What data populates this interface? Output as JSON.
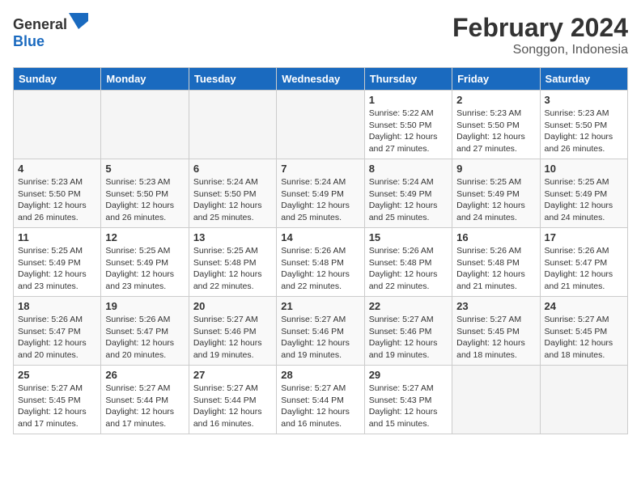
{
  "header": {
    "logo_general": "General",
    "logo_blue": "Blue",
    "month_title": "February 2024",
    "location": "Songgon, Indonesia"
  },
  "days_of_week": [
    "Sunday",
    "Monday",
    "Tuesday",
    "Wednesday",
    "Thursday",
    "Friday",
    "Saturday"
  ],
  "weeks": [
    [
      {
        "day": "",
        "info": ""
      },
      {
        "day": "",
        "info": ""
      },
      {
        "day": "",
        "info": ""
      },
      {
        "day": "",
        "info": ""
      },
      {
        "day": "1",
        "info": "Sunrise: 5:22 AM\nSunset: 5:50 PM\nDaylight: 12 hours\nand 27 minutes."
      },
      {
        "day": "2",
        "info": "Sunrise: 5:23 AM\nSunset: 5:50 PM\nDaylight: 12 hours\nand 27 minutes."
      },
      {
        "day": "3",
        "info": "Sunrise: 5:23 AM\nSunset: 5:50 PM\nDaylight: 12 hours\nand 26 minutes."
      }
    ],
    [
      {
        "day": "4",
        "info": "Sunrise: 5:23 AM\nSunset: 5:50 PM\nDaylight: 12 hours\nand 26 minutes."
      },
      {
        "day": "5",
        "info": "Sunrise: 5:23 AM\nSunset: 5:50 PM\nDaylight: 12 hours\nand 26 minutes."
      },
      {
        "day": "6",
        "info": "Sunrise: 5:24 AM\nSunset: 5:50 PM\nDaylight: 12 hours\nand 25 minutes."
      },
      {
        "day": "7",
        "info": "Sunrise: 5:24 AM\nSunset: 5:49 PM\nDaylight: 12 hours\nand 25 minutes."
      },
      {
        "day": "8",
        "info": "Sunrise: 5:24 AM\nSunset: 5:49 PM\nDaylight: 12 hours\nand 25 minutes."
      },
      {
        "day": "9",
        "info": "Sunrise: 5:25 AM\nSunset: 5:49 PM\nDaylight: 12 hours\nand 24 minutes."
      },
      {
        "day": "10",
        "info": "Sunrise: 5:25 AM\nSunset: 5:49 PM\nDaylight: 12 hours\nand 24 minutes."
      }
    ],
    [
      {
        "day": "11",
        "info": "Sunrise: 5:25 AM\nSunset: 5:49 PM\nDaylight: 12 hours\nand 23 minutes."
      },
      {
        "day": "12",
        "info": "Sunrise: 5:25 AM\nSunset: 5:49 PM\nDaylight: 12 hours\nand 23 minutes."
      },
      {
        "day": "13",
        "info": "Sunrise: 5:25 AM\nSunset: 5:48 PM\nDaylight: 12 hours\nand 22 minutes."
      },
      {
        "day": "14",
        "info": "Sunrise: 5:26 AM\nSunset: 5:48 PM\nDaylight: 12 hours\nand 22 minutes."
      },
      {
        "day": "15",
        "info": "Sunrise: 5:26 AM\nSunset: 5:48 PM\nDaylight: 12 hours\nand 22 minutes."
      },
      {
        "day": "16",
        "info": "Sunrise: 5:26 AM\nSunset: 5:48 PM\nDaylight: 12 hours\nand 21 minutes."
      },
      {
        "day": "17",
        "info": "Sunrise: 5:26 AM\nSunset: 5:47 PM\nDaylight: 12 hours\nand 21 minutes."
      }
    ],
    [
      {
        "day": "18",
        "info": "Sunrise: 5:26 AM\nSunset: 5:47 PM\nDaylight: 12 hours\nand 20 minutes."
      },
      {
        "day": "19",
        "info": "Sunrise: 5:26 AM\nSunset: 5:47 PM\nDaylight: 12 hours\nand 20 minutes."
      },
      {
        "day": "20",
        "info": "Sunrise: 5:27 AM\nSunset: 5:46 PM\nDaylight: 12 hours\nand 19 minutes."
      },
      {
        "day": "21",
        "info": "Sunrise: 5:27 AM\nSunset: 5:46 PM\nDaylight: 12 hours\nand 19 minutes."
      },
      {
        "day": "22",
        "info": "Sunrise: 5:27 AM\nSunset: 5:46 PM\nDaylight: 12 hours\nand 19 minutes."
      },
      {
        "day": "23",
        "info": "Sunrise: 5:27 AM\nSunset: 5:45 PM\nDaylight: 12 hours\nand 18 minutes."
      },
      {
        "day": "24",
        "info": "Sunrise: 5:27 AM\nSunset: 5:45 PM\nDaylight: 12 hours\nand 18 minutes."
      }
    ],
    [
      {
        "day": "25",
        "info": "Sunrise: 5:27 AM\nSunset: 5:45 PM\nDaylight: 12 hours\nand 17 minutes."
      },
      {
        "day": "26",
        "info": "Sunrise: 5:27 AM\nSunset: 5:44 PM\nDaylight: 12 hours\nand 17 minutes."
      },
      {
        "day": "27",
        "info": "Sunrise: 5:27 AM\nSunset: 5:44 PM\nDaylight: 12 hours\nand 16 minutes."
      },
      {
        "day": "28",
        "info": "Sunrise: 5:27 AM\nSunset: 5:44 PM\nDaylight: 12 hours\nand 16 minutes."
      },
      {
        "day": "29",
        "info": "Sunrise: 5:27 AM\nSunset: 5:43 PM\nDaylight: 12 hours\nand 15 minutes."
      },
      {
        "day": "",
        "info": ""
      },
      {
        "day": "",
        "info": ""
      }
    ]
  ]
}
